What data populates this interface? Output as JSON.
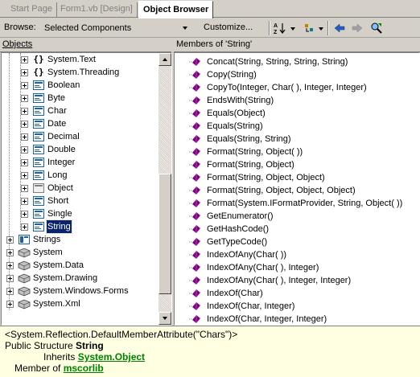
{
  "tabs": [
    {
      "label": "Start Page",
      "active": false
    },
    {
      "label": "Form1.vb [Design]",
      "active": false
    },
    {
      "label": "Object Browser",
      "active": true
    }
  ],
  "toolbar": {
    "browse_label": "Browse:",
    "browse_value": "Selected Components",
    "customize_label": "Customize..."
  },
  "objects_pane": {
    "title": "Objects",
    "items": [
      {
        "label": "System.Text",
        "icon": "namespace-icon",
        "level": 3
      },
      {
        "label": "System.Threading",
        "icon": "namespace-icon",
        "level": 3
      },
      {
        "label": "Boolean",
        "icon": "structure-icon",
        "level": 3
      },
      {
        "label": "Byte",
        "icon": "structure-icon",
        "level": 3
      },
      {
        "label": "Char",
        "icon": "structure-icon",
        "level": 3
      },
      {
        "label": "Date",
        "icon": "structure-icon",
        "level": 3
      },
      {
        "label": "Decimal",
        "icon": "structure-icon",
        "level": 3
      },
      {
        "label": "Double",
        "icon": "structure-icon",
        "level": 3
      },
      {
        "label": "Integer",
        "icon": "structure-icon",
        "level": 3
      },
      {
        "label": "Long",
        "icon": "structure-icon",
        "level": 3
      },
      {
        "label": "Object",
        "icon": "class-icon",
        "level": 3
      },
      {
        "label": "Short",
        "icon": "structure-icon",
        "level": 3
      },
      {
        "label": "Single",
        "icon": "structure-icon",
        "level": 3
      },
      {
        "label": "String",
        "icon": "structure-icon",
        "level": 3,
        "selected": true
      },
      {
        "label": "Strings",
        "icon": "module-icon",
        "level": 1
      },
      {
        "label": "System",
        "icon": "assembly-icon",
        "level": 1
      },
      {
        "label": "System.Data",
        "icon": "assembly-icon",
        "level": 1
      },
      {
        "label": "System.Drawing",
        "icon": "assembly-icon",
        "level": 1
      },
      {
        "label": "System.Windows.Forms",
        "icon": "assembly-icon",
        "level": 1
      },
      {
        "label": "System.Xml",
        "icon": "assembly-icon",
        "level": 1
      }
    ]
  },
  "members_pane": {
    "title": "Members of 'String'",
    "items": [
      "Concat(String, String, String, String)",
      "Copy(String)",
      "CopyTo(Integer, Char( ), Integer, Integer)",
      "EndsWith(String)",
      "Equals(Object)",
      "Equals(String)",
      "Equals(String, String)",
      "Format(String, Object( ))",
      "Format(String, Object)",
      "Format(String, Object, Object)",
      "Format(String, Object, Object, Object)",
      "Format(System.IFormatProvider, String, Object( ))",
      "GetEnumerator()",
      "GetHashCode()",
      "GetTypeCode()",
      "IndexOfAny(Char( ))",
      "IndexOfAny(Char( ), Integer)",
      "IndexOfAny(Char( ), Integer, Integer)",
      "IndexOf(Char)",
      "IndexOf(Char, Integer)",
      "IndexOf(Char, Integer, Integer)"
    ]
  },
  "description": {
    "attribute": "<System.Reflection.DefaultMemberAttribute(\"Chars\")>",
    "declaration_prefix": "Public Structure ",
    "declaration_name": "String",
    "inherits_label": "Inherits ",
    "inherits_link": "System.Object",
    "member_of_label": "Member of ",
    "member_of_link": "mscorlib"
  },
  "colors": {
    "selection": "#0a246a",
    "description_bg": "#ffffe1",
    "link": "#008000",
    "method_icon": "#800080"
  }
}
